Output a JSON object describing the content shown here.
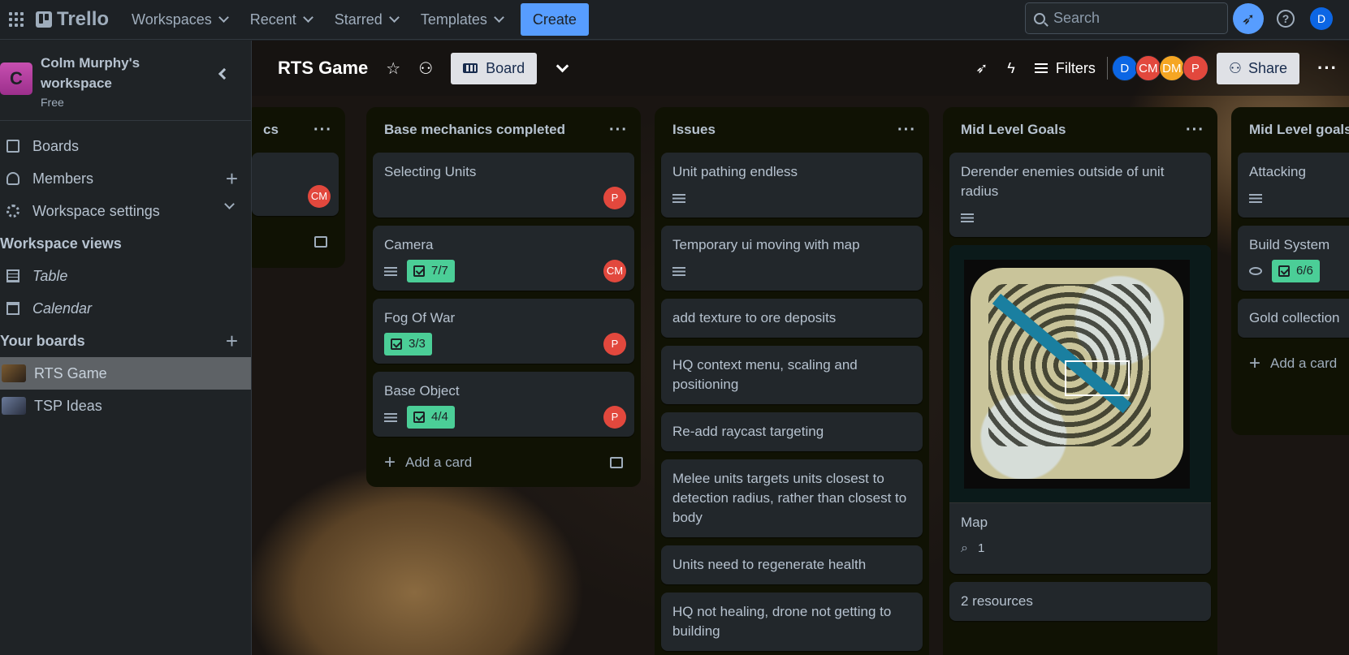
{
  "topnav": {
    "logo": "Trello",
    "menus": [
      "Workspaces",
      "Recent",
      "Starred",
      "Templates"
    ],
    "create": "Create",
    "search_placeholder": "Search",
    "help": "?",
    "user_initial": "D"
  },
  "sidebar": {
    "workspace_initial": "C",
    "workspace_name": "Colm Murphy's workspace",
    "workspace_plan": "Free",
    "items": [
      {
        "label": "Boards"
      },
      {
        "label": "Members"
      },
      {
        "label": "Workspace settings"
      }
    ],
    "views_title": "Workspace views",
    "views": [
      {
        "label": "Table"
      },
      {
        "label": "Calendar"
      }
    ],
    "boards_title": "Your boards",
    "boards": [
      {
        "label": "RTS Game",
        "active": true
      },
      {
        "label": "TSP Ideas"
      }
    ]
  },
  "board": {
    "title": "RTS Game",
    "view": "Board",
    "filters": "Filters",
    "share": "Share",
    "members": [
      {
        "initials": "D",
        "color": "#0c66e4"
      },
      {
        "initials": "CM",
        "color": "#e2483d"
      },
      {
        "initials": "DM",
        "color": "#f5a623"
      },
      {
        "initials": "P",
        "color": "#e2483d"
      }
    ]
  },
  "lists": [
    {
      "title": "cs",
      "cards": [
        {
          "title": "",
          "member": "CM"
        }
      ],
      "add_card": ""
    },
    {
      "title": "Base mechanics completed",
      "cards": [
        {
          "title": "Selecting Units",
          "member": "P"
        },
        {
          "title": "Camera",
          "checklist": "7/7",
          "member": "CM"
        },
        {
          "title": "Fog Of War",
          "checklist": "3/3",
          "member": "P"
        },
        {
          "title": "Base Object",
          "checklist": "4/4",
          "member": "P"
        }
      ],
      "add_card": "Add a card"
    },
    {
      "title": "Issues",
      "cards": [
        {
          "title": "Unit pathing endless"
        },
        {
          "title": "Temporary ui moving with map"
        },
        {
          "title": "add texture to ore deposits"
        },
        {
          "title": "HQ context menu, scaling and positioning"
        },
        {
          "title": "Re-add raycast targeting"
        },
        {
          "title": "Melee units targets units closest to detection radius, rather than closest to body"
        },
        {
          "title": "Units need to regenerate health"
        },
        {
          "title": "HQ not healing, drone not getting to building"
        }
      ]
    },
    {
      "title": "Mid Level Goals",
      "cards": [
        {
          "title": "Derender enemies outside of unit radius"
        },
        {
          "title": "Map",
          "attachments": "1"
        },
        {
          "title": "2 resources"
        }
      ]
    },
    {
      "title": "Mid Level goals",
      "cards": [
        {
          "title": "Attacking"
        },
        {
          "title": "Build System",
          "checklist": "6/6"
        },
        {
          "title": "Gold collection"
        }
      ],
      "add_card": "Add a card"
    }
  ],
  "colors": {
    "accent": "#579dff",
    "check": "#4bce97",
    "red_member": "#e2483d"
  }
}
